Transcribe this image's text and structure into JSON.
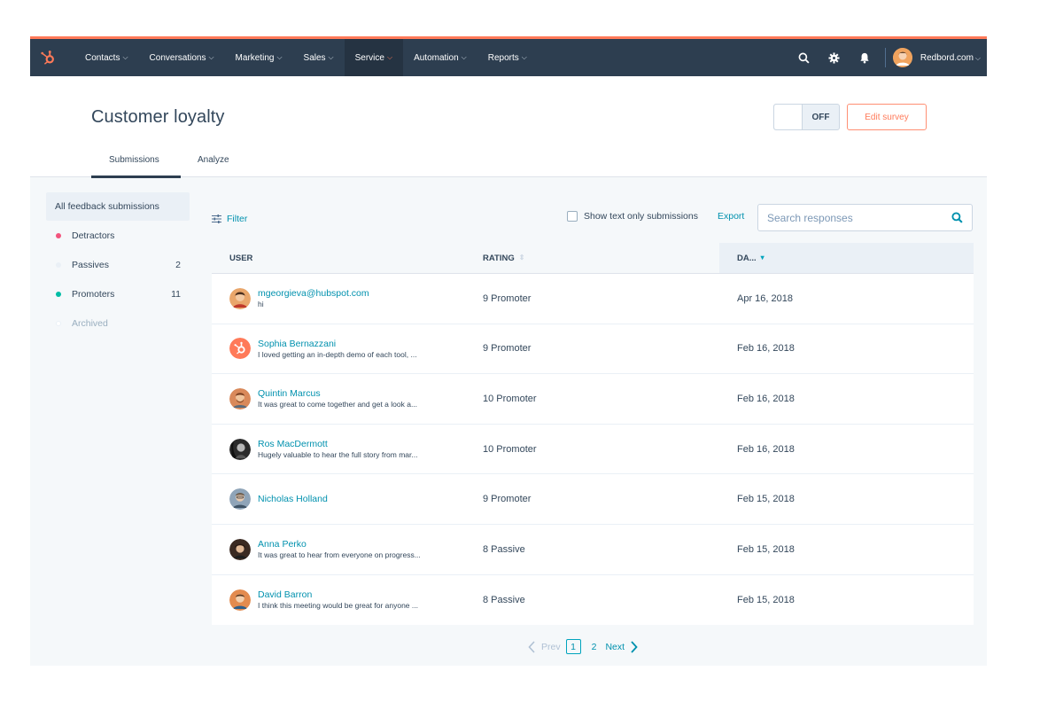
{
  "nav": {
    "items": [
      {
        "label": "Contacts"
      },
      {
        "label": "Conversations"
      },
      {
        "label": "Marketing"
      },
      {
        "label": "Sales"
      },
      {
        "label": "Service"
      },
      {
        "label": "Automation"
      },
      {
        "label": "Reports"
      }
    ],
    "active": "Service",
    "account": "Redbord.com",
    "brand_color": "#ff7a59",
    "bar_color": "#2d3e50"
  },
  "header": {
    "title": "Customer loyalty",
    "toggle_label": "OFF",
    "edit_button": "Edit survey",
    "tabs": [
      {
        "label": "Submissions",
        "active": true
      },
      {
        "label": "Analyze",
        "active": false
      }
    ]
  },
  "sidebar": {
    "all_label": "All feedback submissions",
    "items": [
      {
        "label": "Detractors",
        "count": "",
        "color": "#f2547d"
      },
      {
        "label": "Passives",
        "count": "2",
        "color": "#eaf0f6"
      },
      {
        "label": "Promoters",
        "count": "11",
        "color": "#00bda5"
      },
      {
        "label": "Archived",
        "count": "",
        "color": "#eaf0f6"
      }
    ]
  },
  "toolbar": {
    "filter_label": "Filter",
    "show_text_label": "Show text only submissions",
    "show_text_checked": false,
    "export_label": "Export",
    "search_placeholder": "Search responses"
  },
  "table": {
    "columns": {
      "user": "USER",
      "rating": "RATING",
      "date": "DA..."
    },
    "rows": [
      {
        "name": "mgeorgieva@hubspot.com",
        "message": "hi",
        "rating": "9 Promoter",
        "date": "Apr 16, 2018",
        "avatar_icon": "person-avatar-icon"
      },
      {
        "name": "Sophia Bernazzani",
        "message": "I loved getting an in-depth demo of each tool, ...",
        "rating": "9 Promoter",
        "date": "Feb 16, 2018",
        "avatar_icon": "hubspot-logo-icon"
      },
      {
        "name": "Quintin Marcus",
        "message": "It was great to come together and get a look a...",
        "rating": "10 Promoter",
        "date": "Feb 16, 2018",
        "avatar_icon": "person-avatar-icon"
      },
      {
        "name": "Ros MacDermott",
        "message": "Hugely valuable to hear the full story from mar...",
        "rating": "10 Promoter",
        "date": "Feb 16, 2018",
        "avatar_icon": "person-avatar-icon"
      },
      {
        "name": "Nicholas Holland",
        "message": "",
        "rating": "9 Promoter",
        "date": "Feb 15, 2018",
        "avatar_icon": "person-avatar-icon"
      },
      {
        "name": "Anna Perko",
        "message": "It was great to hear from everyone on progress...",
        "rating": "8 Passive",
        "date": "Feb 15, 2018",
        "avatar_icon": "person-avatar-icon"
      },
      {
        "name": "David Barron",
        "message": "I think this meeting would be great for anyone ...",
        "rating": "8 Passive",
        "date": "Feb 15, 2018",
        "avatar_icon": "person-avatar-icon"
      }
    ]
  },
  "pagination": {
    "prev": "Prev",
    "current": "1",
    "next_page": "2",
    "next": "Next"
  }
}
